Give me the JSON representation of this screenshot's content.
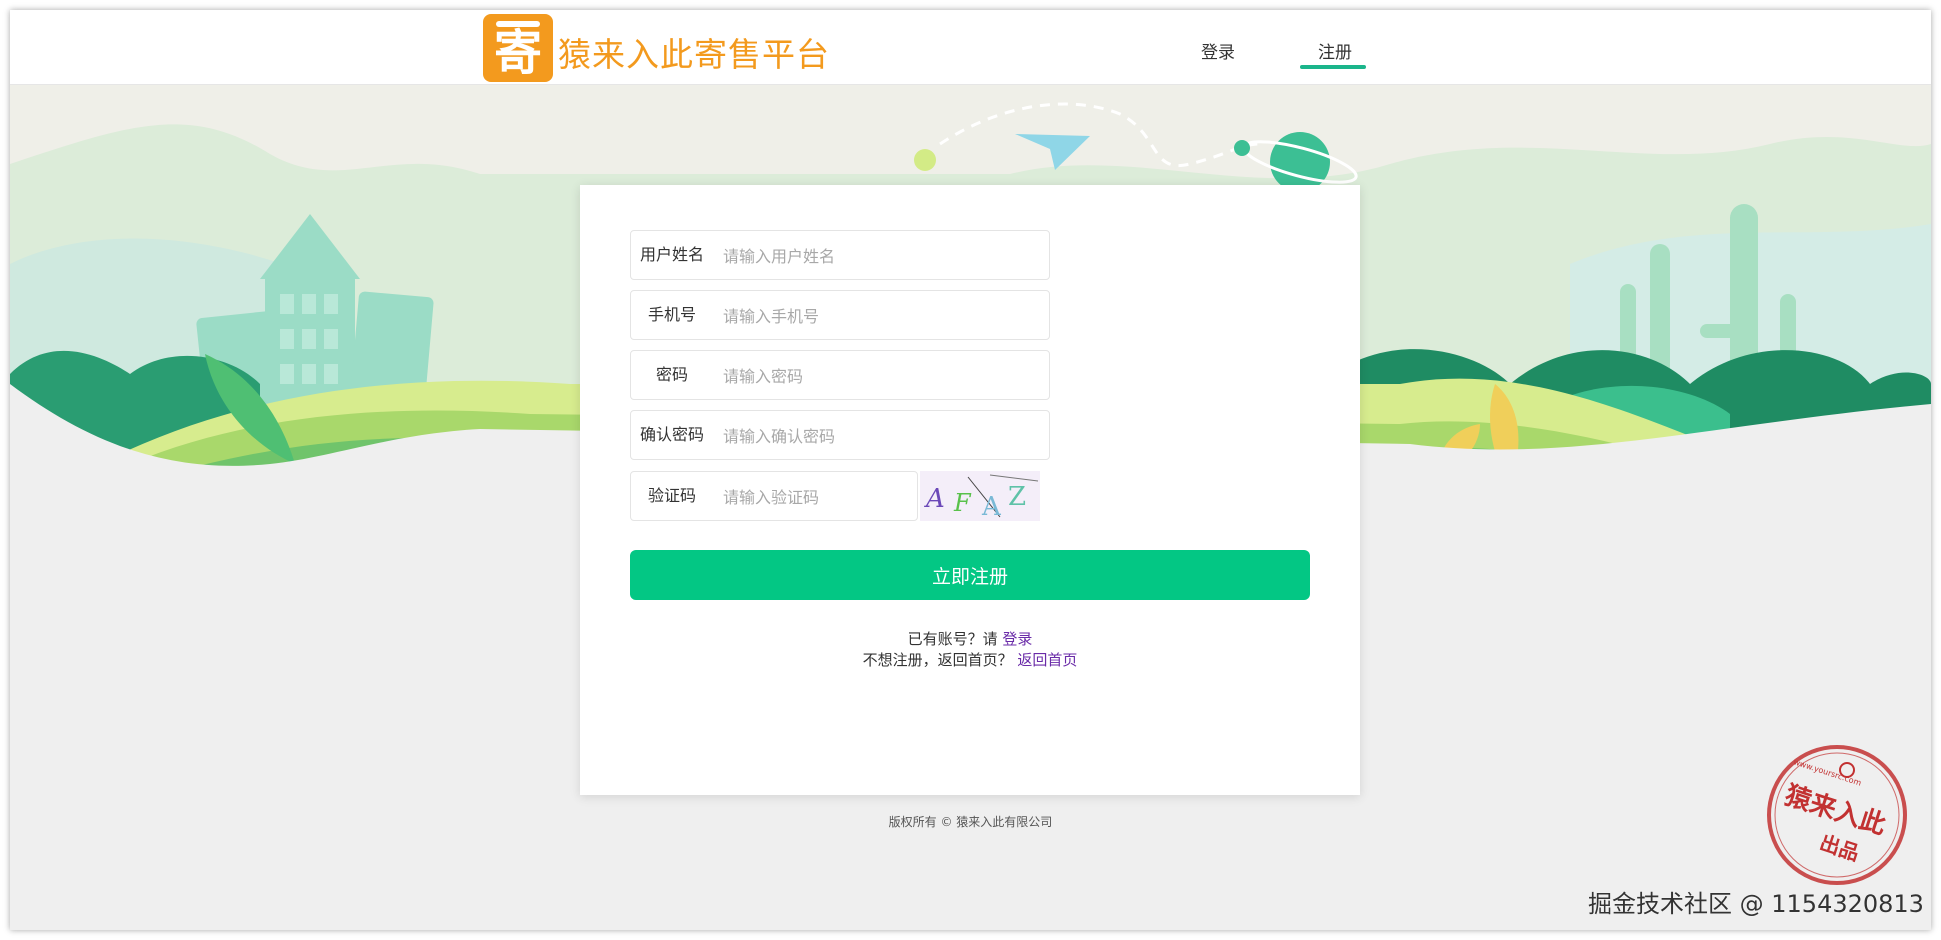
{
  "header": {
    "logo_char": "寄",
    "brand": "猿来入此寄售平台",
    "nav": {
      "login": "登录",
      "register": "注册"
    },
    "active_nav": "注册",
    "accent": "#1bb58b"
  },
  "form": {
    "fields": [
      {
        "label": "用户姓名",
        "placeholder": "请输入用户姓名"
      },
      {
        "label": "手机号",
        "placeholder": "请输入手机号"
      },
      {
        "label": "密码",
        "placeholder": "请输入密码"
      },
      {
        "label": "确认密码",
        "placeholder": "请输入确认密码"
      },
      {
        "label": "验证码",
        "placeholder": "请输入验证码"
      }
    ],
    "captcha_chars": [
      "A",
      "F",
      "A",
      "Z"
    ],
    "submit": "立即注册",
    "submit_color": "#03c784",
    "login_prompt": "已有账号？请 ",
    "login_link": "登录",
    "home_prompt": "不想注册，返回首页？ ",
    "home_link": "返回首页"
  },
  "footer": {
    "copyright": "版权所有 © 猿来入此有限公司"
  },
  "stamp": {
    "main": "猿来入此",
    "sub": "出品",
    "url": "www.yoursrc.com"
  },
  "watermark": "掘金技术社区 @ 1154320813"
}
